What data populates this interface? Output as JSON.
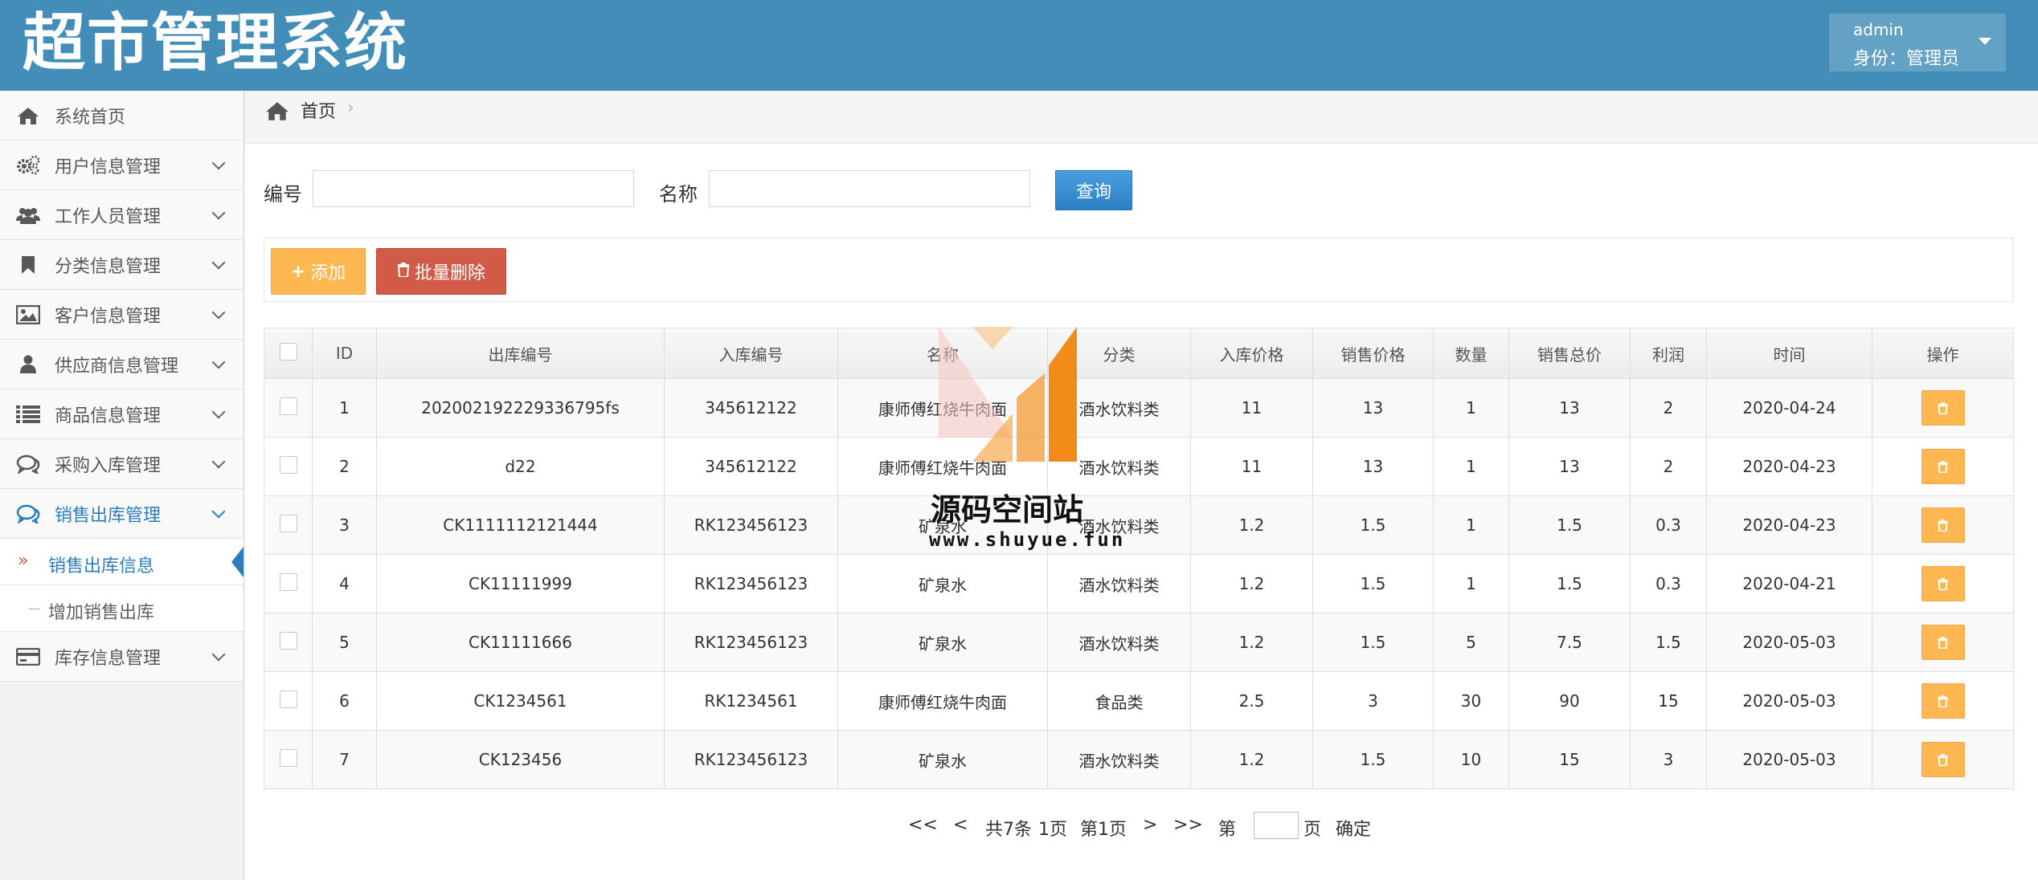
{
  "header": {
    "logo": "超市管理系统",
    "user": {
      "name": "admin",
      "role": "身份：管理员"
    }
  },
  "sidebar": {
    "items": [
      {
        "label": "系统首页",
        "icon": "home-icon"
      },
      {
        "label": "用户信息管理",
        "icon": "gears-icon"
      },
      {
        "label": "工作人员管理",
        "icon": "users-icon"
      },
      {
        "label": "分类信息管理",
        "icon": "bookmark-icon"
      },
      {
        "label": "客户信息管理",
        "icon": "picture-icon"
      },
      {
        "label": "供应商信息管理",
        "icon": "user-icon"
      },
      {
        "label": "商品信息管理",
        "icon": "list-icon"
      },
      {
        "label": "采购入库管理",
        "icon": "comments-icon"
      },
      {
        "label": "销售出库管理",
        "icon": "comments-icon"
      },
      {
        "label": "库存信息管理",
        "icon": "credit-card-icon"
      }
    ],
    "subitems": [
      {
        "label": "销售出库信息"
      },
      {
        "label": "增加销售出库"
      }
    ]
  },
  "breadcrumb": {
    "home": "首页",
    "separator": "›"
  },
  "search": {
    "code_label": "编号",
    "name_label": "名称",
    "code_value": "",
    "name_value": "",
    "button": "查询"
  },
  "toolbar": {
    "add": "添加",
    "batch_delete": "批量删除"
  },
  "table": {
    "headers": [
      "ID",
      "出库编号",
      "入库编号",
      "名称",
      "分类",
      "入库价格",
      "销售价格",
      "数量",
      "销售总价",
      "利润",
      "时间",
      "操作"
    ],
    "rows": [
      [
        "1",
        "202002192229336795fs",
        "345612122",
        "康师傅红烧牛肉面",
        "酒水饮料类",
        "11",
        "13",
        "1",
        "13",
        "2",
        "2020-04-24"
      ],
      [
        "2",
        "d22",
        "345612122",
        "康师傅红烧牛肉面",
        "酒水饮料类",
        "11",
        "13",
        "1",
        "13",
        "2",
        "2020-04-23"
      ],
      [
        "3",
        "CK1111112121444",
        "RK123456123",
        "矿泉水",
        "酒水饮料类",
        "1.2",
        "1.5",
        "1",
        "1.5",
        "0.3",
        "2020-04-23"
      ],
      [
        "4",
        "CK11111999",
        "RK123456123",
        "矿泉水",
        "酒水饮料类",
        "1.2",
        "1.5",
        "1",
        "1.5",
        "0.3",
        "2020-04-21"
      ],
      [
        "5",
        "CK11111666",
        "RK123456123",
        "矿泉水",
        "酒水饮料类",
        "1.2",
        "1.5",
        "5",
        "7.5",
        "1.5",
        "2020-05-03"
      ],
      [
        "6",
        "CK1234561",
        "RK1234561",
        "康师傅红烧牛肉面",
        "食品类",
        "2.5",
        "3",
        "30",
        "90",
        "15",
        "2020-05-03"
      ],
      [
        "7",
        "CK123456",
        "RK123456123",
        "矿泉水",
        "酒水饮料类",
        "1.2",
        "1.5",
        "10",
        "15",
        "3",
        "2020-05-03"
      ]
    ]
  },
  "pagination": {
    "first": "<<",
    "prev": "<",
    "total": "共7条",
    "pages": "1页",
    "current": "第1页",
    "next": ">",
    "last": ">>",
    "goto_prefix": "第",
    "goto_suffix": "页",
    "confirm": "确定",
    "page_value": ""
  },
  "watermark": {
    "title": "源码空间站",
    "url": "www.shuyue.fun"
  },
  "colors": {
    "header": "#438eb9",
    "accent": "#2b7dbc",
    "warning": "#ffb752",
    "danger": "#d15b47"
  }
}
